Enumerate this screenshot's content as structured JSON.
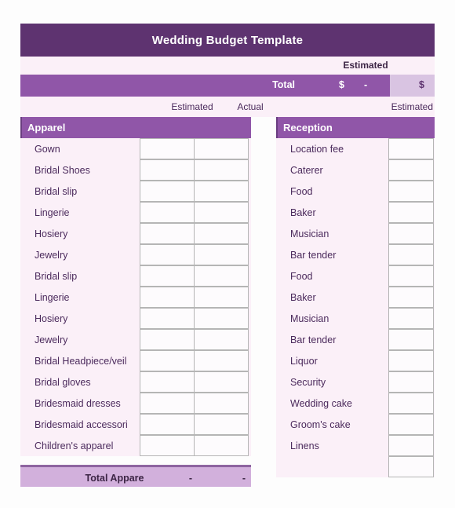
{
  "document": {
    "title": "Wedding Budget Template"
  },
  "summary": {
    "estimated_band_label": "Estimated",
    "total_label": "Total",
    "total_currency_symbol": "$",
    "total_value": "-",
    "total_alt_currency_symbol": "$"
  },
  "column_headers": {
    "left_estimated": "Estimated",
    "left_actual": "Actual",
    "right_estimated": "Estimated"
  },
  "sections": [
    {
      "name": "apparel",
      "title": "Apparel",
      "columns": [
        "Estimated",
        "Actual"
      ],
      "rows": [
        {
          "label": "Gown",
          "estimated": "",
          "actual": ""
        },
        {
          "label": "Bridal Shoes",
          "estimated": "",
          "actual": ""
        },
        {
          "label": "Bridal slip",
          "estimated": "",
          "actual": ""
        },
        {
          "label": "Lingerie",
          "estimated": "",
          "actual": ""
        },
        {
          "label": "Hosiery",
          "estimated": "",
          "actual": ""
        },
        {
          "label": "Jewelry",
          "estimated": "",
          "actual": ""
        },
        {
          "label": "Bridal slip",
          "estimated": "",
          "actual": ""
        },
        {
          "label": "Lingerie",
          "estimated": "",
          "actual": ""
        },
        {
          "label": "Hosiery",
          "estimated": "",
          "actual": ""
        },
        {
          "label": "Jewelry",
          "estimated": "",
          "actual": ""
        },
        {
          "label": "Bridal Headpiece/veil",
          "estimated": "",
          "actual": ""
        },
        {
          "label": "Bridal gloves",
          "estimated": "",
          "actual": ""
        },
        {
          "label": "Bridesmaid dresses",
          "estimated": "",
          "actual": ""
        },
        {
          "label": "Bridesmaid accessori",
          "estimated": "",
          "actual": ""
        },
        {
          "label": "Children's apparel",
          "estimated": "",
          "actual": ""
        }
      ],
      "total": {
        "label": "Total Appare",
        "estimated": "-",
        "actual": "-"
      }
    },
    {
      "name": "reception",
      "title": "Reception",
      "columns": [
        "Estimated"
      ],
      "rows": [
        {
          "label": "Location fee",
          "estimated": ""
        },
        {
          "label": "Caterer",
          "estimated": ""
        },
        {
          "label": "Food",
          "estimated": ""
        },
        {
          "label": "Baker",
          "estimated": ""
        },
        {
          "label": "Musician",
          "estimated": ""
        },
        {
          "label": "Bar tender",
          "estimated": ""
        },
        {
          "label": "Food",
          "estimated": ""
        },
        {
          "label": "Baker",
          "estimated": ""
        },
        {
          "label": "Musician",
          "estimated": ""
        },
        {
          "label": "Bar tender",
          "estimated": ""
        },
        {
          "label": "Liquor",
          "estimated": ""
        },
        {
          "label": "Security",
          "estimated": ""
        },
        {
          "label": "Wedding cake",
          "estimated": ""
        },
        {
          "label": "Groom's cake",
          "estimated": ""
        },
        {
          "label": "Linens",
          "estimated": ""
        },
        {
          "label": "",
          "estimated": ""
        }
      ]
    }
  ],
  "colors": {
    "title_bar": "#5e3370",
    "section_header": "#9056a8",
    "row_background": "#fbf0f8",
    "total_footer": "#d2b0dc",
    "total_alt_cell": "#d9c4e2",
    "text_purple": "#4b2a5c"
  }
}
